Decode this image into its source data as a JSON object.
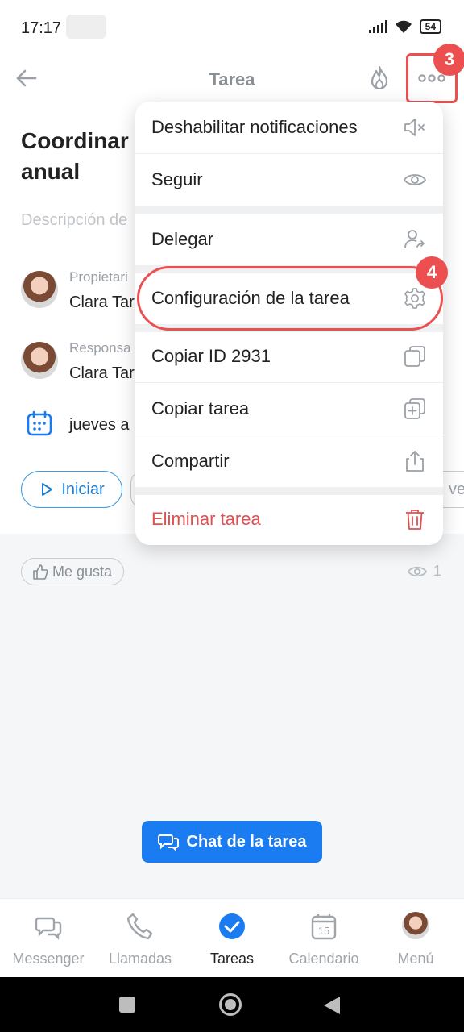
{
  "status_bar": {
    "time": "17:17",
    "battery": "54"
  },
  "header": {
    "title": "Tarea"
  },
  "badges": {
    "more": "3",
    "config": "4"
  },
  "task": {
    "title_line1": "Coordinar l",
    "title_line2": "anual",
    "description_placeholder": "Descripción de"
  },
  "people": [
    {
      "role": "Propietari",
      "name": "Clara Tar"
    },
    {
      "role": "Responsa",
      "name": "Clara Tar"
    }
  ],
  "deadline": "jueves a",
  "actions": {
    "start": "Iniciar",
    "right_partial": "ve"
  },
  "feedback": {
    "like": "Me gusta",
    "views": "1"
  },
  "chat_button": "Chat de la tarea",
  "bottom_nav": [
    {
      "label": "Messenger"
    },
    {
      "label": "Llamadas"
    },
    {
      "label": "Tareas"
    },
    {
      "label": "Calendario",
      "day": "15"
    },
    {
      "label": "Menú"
    }
  ],
  "menu": [
    {
      "label": "Deshabilitar notificaciones",
      "icon": "mute-icon"
    },
    {
      "label": "Seguir",
      "icon": "eye-icon"
    },
    {
      "label": "Delegar",
      "icon": "delegate-user-icon"
    },
    {
      "label": "Configuración de la tarea",
      "icon": "gear-icon"
    },
    {
      "label": "Copiar ID 2931",
      "icon": "copy-icon"
    },
    {
      "label": "Copiar tarea",
      "icon": "copy-add-icon"
    },
    {
      "label": "Compartir",
      "icon": "share-icon"
    },
    {
      "label": "Eliminar tarea",
      "icon": "trash-icon"
    }
  ],
  "colors": {
    "accent": "#1a7cf0",
    "highlight": "#ec4f4f",
    "danger": "#e05050"
  }
}
